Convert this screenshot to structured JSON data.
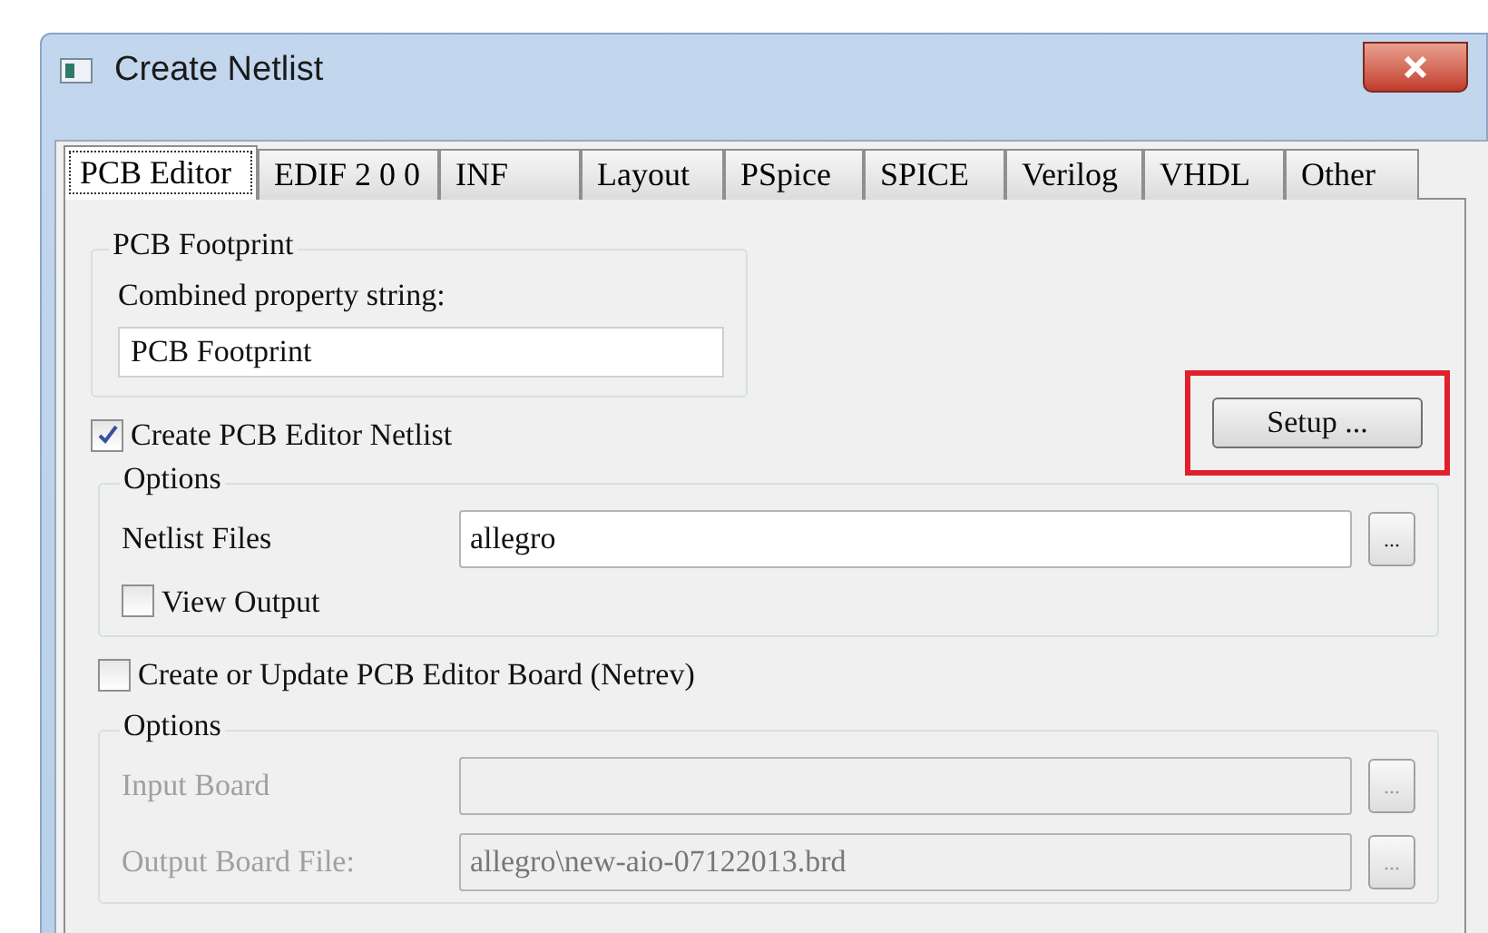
{
  "window": {
    "title": "Create Netlist"
  },
  "tabs": [
    {
      "label": "PCB Editor",
      "selected": true
    },
    {
      "label": "EDIF 2 0 0",
      "selected": false
    },
    {
      "label": "INF",
      "selected": false
    },
    {
      "label": "Layout",
      "selected": false
    },
    {
      "label": "PSpice",
      "selected": false
    },
    {
      "label": "SPICE",
      "selected": false
    },
    {
      "label": "Verilog",
      "selected": false
    },
    {
      "label": "VHDL",
      "selected": false
    },
    {
      "label": "Other",
      "selected": false
    }
  ],
  "footprint": {
    "legend": "PCB Footprint",
    "label": "Combined property string:",
    "value": "PCB Footprint"
  },
  "netlist_checkbox": {
    "label": "Create PCB Editor Netlist",
    "checked": true
  },
  "setup_button": {
    "label": "Setup ...",
    "highlighted": true
  },
  "netlist_options": {
    "legend": "Options",
    "disabled": false,
    "fields": [
      {
        "label": "Netlist Files",
        "value": "allegro",
        "browse": "..."
      }
    ],
    "view_output": {
      "label": "View Output",
      "checked": false
    }
  },
  "netrev_checkbox": {
    "label": "Create or Update PCB Editor Board (Netrev)",
    "checked": false
  },
  "netrev_options": {
    "legend": "Options",
    "disabled": true,
    "fields": [
      {
        "label": "Input Board",
        "browse": "..."
      },
      {
        "label": "Output Board File:",
        "value": "allegro\\new-aio-07122013.brd",
        "browse": "..."
      }
    ]
  }
}
